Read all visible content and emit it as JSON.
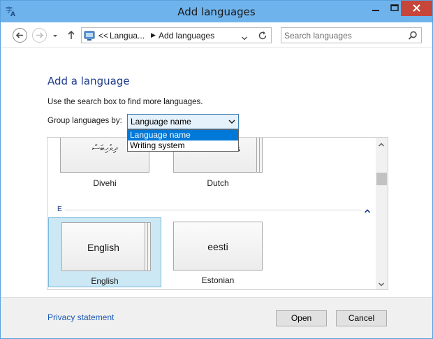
{
  "window": {
    "title": "Add languages"
  },
  "address_bar": {
    "overflow": "<<",
    "crumbs": [
      "Langua...",
      "Add languages"
    ],
    "separator": "▶"
  },
  "search": {
    "placeholder": "Search languages"
  },
  "content": {
    "heading": "Add a language",
    "hint": "Use the search box to find more languages.",
    "group_label": "Group languages by:",
    "group_selected": "Language name",
    "group_options": [
      "Language name",
      "Writing system"
    ]
  },
  "grid": {
    "sections": [
      {
        "letter": "E"
      }
    ],
    "tiles": [
      {
        "card_text": "ދިވެހިބަސް",
        "label": "Divehi"
      },
      {
        "card_text": "Nederlands",
        "label": "Dutch"
      },
      {
        "card_text": "English",
        "label": "English",
        "selected": true
      },
      {
        "card_text": "eesti",
        "label": "Estonian"
      }
    ]
  },
  "footer": {
    "privacy": "Privacy statement",
    "open": "Open",
    "cancel": "Cancel"
  },
  "colors": {
    "titlebar": "#6fb3ec",
    "close_button": "#c7463a",
    "accent": "#0078d7",
    "heading": "#1e3a8a",
    "link": "#1c58b5",
    "selection": "#cce8f4"
  }
}
